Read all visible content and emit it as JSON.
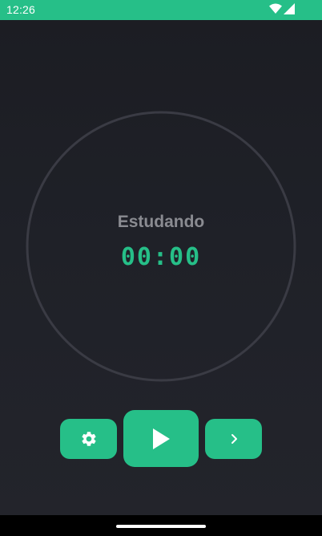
{
  "status_bar": {
    "time": "12:26",
    "icons": [
      "wifi-icon",
      "signal-icon"
    ],
    "background_color": "#26bf88"
  },
  "timer": {
    "phase_label": "Estudando",
    "time": "00:00",
    "accent_color": "#26bf88"
  },
  "controls": {
    "settings_icon": "gear-icon",
    "play_icon": "play-icon",
    "next_icon": "chevron-right-icon"
  },
  "nav_bar": {
    "home_indicator": "home-indicator"
  }
}
